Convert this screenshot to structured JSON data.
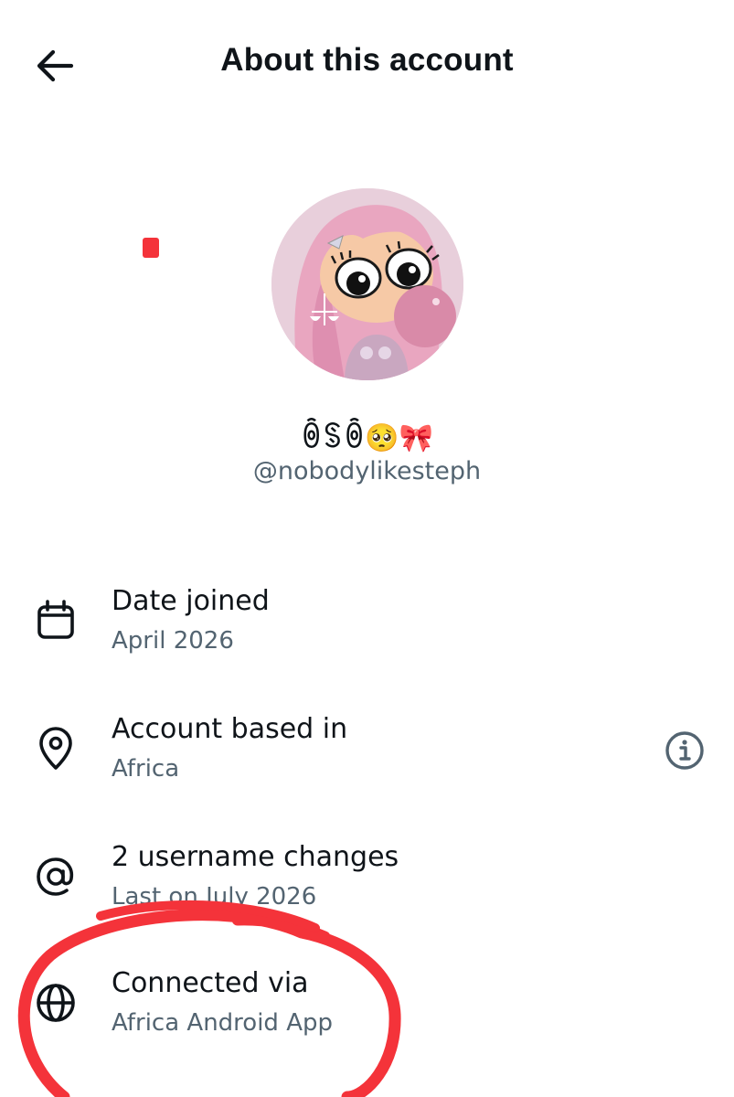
{
  "header": {
    "title": "About this account",
    "back_icon": "arrow-left-icon"
  },
  "profile": {
    "display_name": "ꉺꌗꉺ🥺🎀",
    "handle": "@nobodylikesteph",
    "avatar_alt": "avatar"
  },
  "rows": [
    {
      "icon": "calendar-icon",
      "title": "Date joined",
      "subtitle": "April 2026"
    },
    {
      "icon": "location-pin-icon",
      "title": "Account based in",
      "subtitle": "Africa",
      "action_icon": "info-icon"
    },
    {
      "icon": "at-sign-icon",
      "title": "2 username changes",
      "subtitle": "Last on July 2026"
    },
    {
      "icon": "globe-icon",
      "title": "Connected via",
      "subtitle": "Africa Android App"
    }
  ],
  "colors": {
    "text_primary": "#0f1419",
    "text_secondary": "#536471",
    "annotation_red": "#f4333a",
    "background": "#ffffff"
  }
}
